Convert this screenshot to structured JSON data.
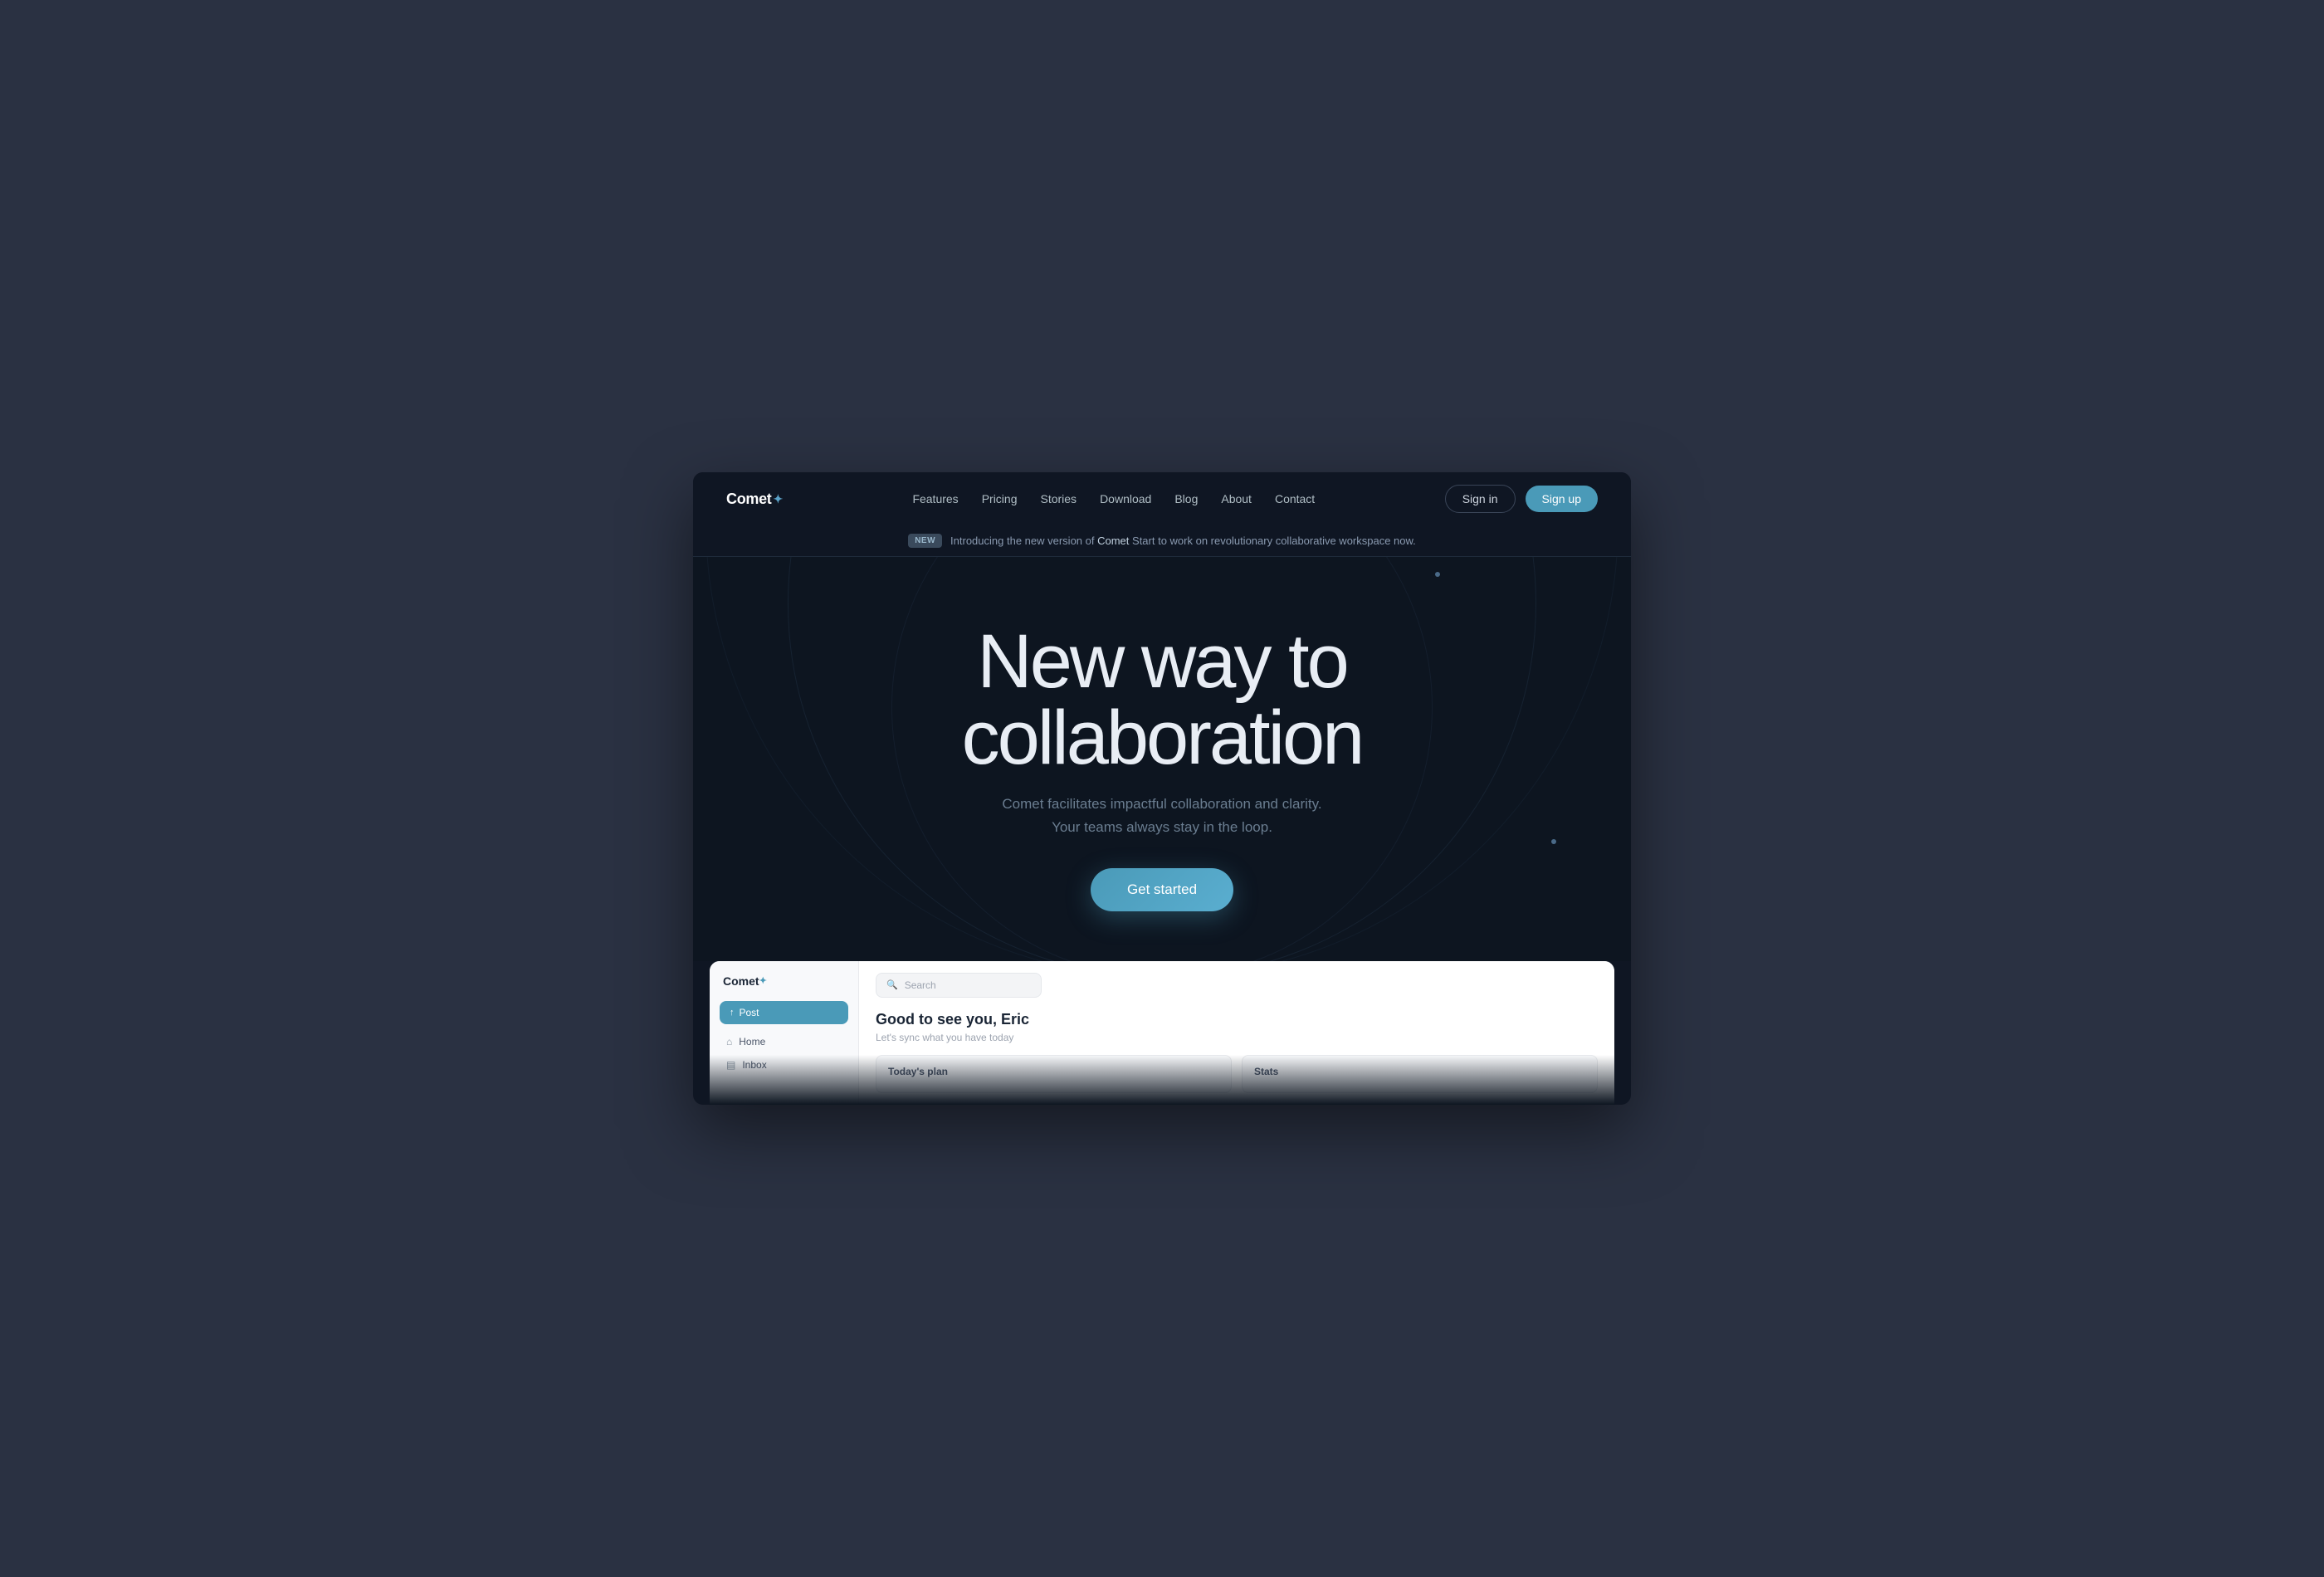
{
  "browser": {
    "background": "#2a3142"
  },
  "nav": {
    "logo": "Comet",
    "logo_star": "✦",
    "links": [
      {
        "id": "features",
        "label": "Features"
      },
      {
        "id": "pricing",
        "label": "Pricing"
      },
      {
        "id": "stories",
        "label": "Stories"
      },
      {
        "id": "download",
        "label": "Download"
      },
      {
        "id": "blog",
        "label": "Blog"
      },
      {
        "id": "about",
        "label": "About"
      },
      {
        "id": "contact",
        "label": "Contact"
      }
    ],
    "sign_in": "Sign in",
    "sign_up": "Sign up"
  },
  "announcement": {
    "badge": "NEW",
    "text_before": "Introducing the new version of ",
    "brand": "Comet",
    "text_after": "  Start to work on revolutionary collaborative workspace now."
  },
  "hero": {
    "title_line1": "New way to",
    "title_line2": "collaboration",
    "subtitle_line1": "Comet facilitates impactful collaboration and clarity.",
    "subtitle_line2": "Your teams always stay in the loop.",
    "cta": "Get started"
  },
  "app_preview": {
    "logo": "Comet",
    "logo_star": "✦",
    "search_placeholder": "Search",
    "post_button": "Post",
    "nav_items": [
      {
        "id": "home",
        "icon": "⌂",
        "label": "Home"
      },
      {
        "id": "inbox",
        "icon": "▤",
        "label": "Inbox"
      }
    ],
    "greeting": "Good to see you, Eric",
    "greeting_sub": "Let's sync what you have today",
    "card1_title": "Today's plan",
    "card2_title": "Stats"
  }
}
